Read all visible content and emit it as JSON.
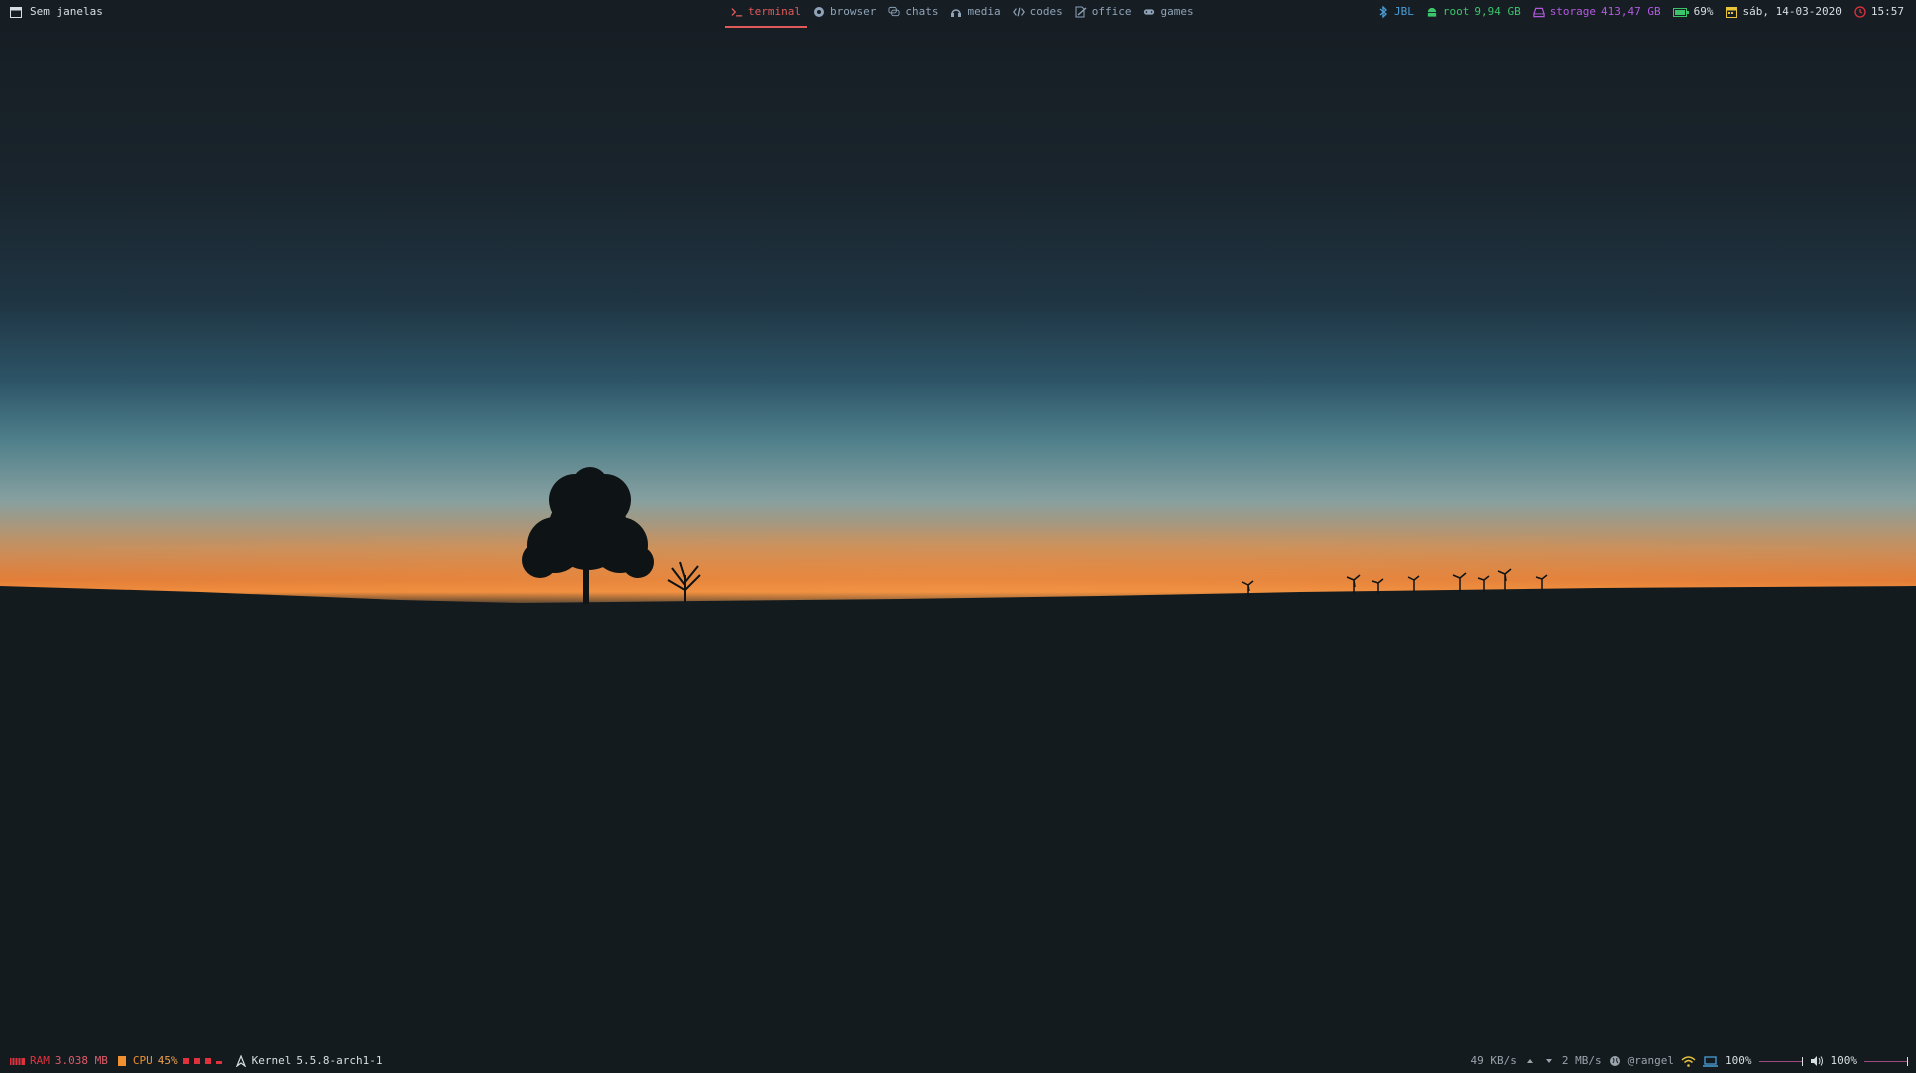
{
  "top_bar": {
    "window_title": "Sem janelas",
    "workspaces": [
      {
        "label": "terminal",
        "icon": "terminal-icon",
        "active": true
      },
      {
        "label": "browser",
        "icon": "browser-globe-icon"
      },
      {
        "label": "chats",
        "icon": "chat-bubbles-icon"
      },
      {
        "label": "media",
        "icon": "headphones-icon"
      },
      {
        "label": "codes",
        "icon": "code-brackets-icon"
      },
      {
        "label": "office",
        "icon": "document-pen-icon"
      },
      {
        "label": "games",
        "icon": "gamepad-icon"
      }
    ],
    "bluetooth": {
      "label": "JBL",
      "color": "#4a9fd8"
    },
    "root": {
      "label": "root",
      "value": "9,94 GB",
      "color": "#3cc46a"
    },
    "storage": {
      "label": "storage",
      "value": "413,47 GB",
      "color": "#b35ae0"
    },
    "battery": {
      "value": "69%",
      "color": "#3cc46a"
    },
    "date": {
      "value": "sáb, 14-03-2020",
      "color": "#e8c33c"
    },
    "time": {
      "value": "15:57",
      "color": "#e0323e"
    }
  },
  "bottom_bar": {
    "ram": {
      "label": "RAM",
      "value": "3.038 MB",
      "color": "#e0323e"
    },
    "cpu": {
      "label": "CPU",
      "value": "45%",
      "color": "#f09030"
    },
    "kernel": {
      "label": "Kernel",
      "value": "5.5.8-arch1-1"
    },
    "net_down": "49 KB/s",
    "net_up": "2 MB/s",
    "hostname": "@rangel",
    "brightness": {
      "value": "100%"
    },
    "volume": {
      "value": "100%"
    }
  },
  "colors": {
    "accent": "#e05a5a",
    "workspace_inactive": "#8fa3b8",
    "bar_text": "#d8dee3"
  }
}
